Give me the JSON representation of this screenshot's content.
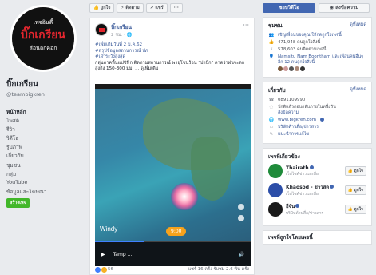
{
  "page": {
    "avatar_top": "เพจอินดี้",
    "avatar_mid": "บิ๊กเกรียน",
    "avatar_bot": "ส่อนถกคอก",
    "name": "บิ๊กเกรียน",
    "handle": "@teambigkren",
    "create_label": "สร้างเพจ"
  },
  "nav": [
    "หน้าหลัก",
    "โพสต์",
    "รีวิว",
    "วิดีโอ",
    "รูปภาพ",
    "เกี่ยวกับ",
    "ชุมชน",
    "กลุ่ม",
    "YouTube",
    "ข้อมูลและโฆษณา"
  ],
  "topbar": {
    "like": "ถูกใจ",
    "follow": "ติดตาม",
    "share": "แชร์",
    "more": "···"
  },
  "post": {
    "author": "บิ๊กเกรียน",
    "time": "2 ชม. · 🌐",
    "more": "···",
    "line1": "#เพิ่มเติมวันที่ 2 ม.ค.62",
    "line2": "#สรุปข้อมูลสถานการณ์ ปภ",
    "line3": "#เฝ้าระวังสูงสุด",
    "line4": "กลุ่มภาคพื้นแปซิฟิก ติดตามสถานการณ์ พายุโซนร้อน \"ปาบึก\" คาดว่าฝนจะตกสูงถึง 150-300 มม. ... ดูเพิ่มเติม",
    "windy": "Windy",
    "time_pill": "9:00",
    "video_label": "Tamp ...",
    "reaction_count": "56",
    "foot_right": "แชร์ 16 ครั้ง  รับชม 2.6 พัน ครั้ง",
    "progress": 0.32
  },
  "right": {
    "liked_label": "ชอบวิดีโอ",
    "message_label": "ส่งข้อความ",
    "community": {
      "title": "ชุมชน",
      "see_all": "ดูทั้งหมด",
      "rows": [
        "เชิญเพื่อนของคุณ ให้กดถูกใจเพจนี้",
        "471,948 คนถูกใจสิ่งนี้",
        "578,603 คนติดตามเพจนี้",
        "Namsitu Nam Boontham และเพื่อนคนอื่นๆ อีก 12 คนถูกใจสิ่งนี้"
      ]
    },
    "about": {
      "title": "เกี่ยวกับ",
      "see_all": "ดูทั้งหมด",
      "phone": "0891109990",
      "reply": "ปกติแล้วตอบกลับภายในหนึ่งวัน",
      "send_msg": "ส่งข้อความ",
      "website": "www.bigkren.com",
      "category": "บริษัทด้านสื่อ/ข่าวสาร",
      "suggest": "แนะนำการแก้ไข"
    },
    "related": {
      "title": "เพจที่เกี่ยวข้อง",
      "items": [
        {
          "name": "Thairath",
          "sub": "เว็บไซต์ข่าวและสื่อ",
          "like": "ถูกใจ",
          "color": "#1f8b3a"
        },
        {
          "name": "Khaosod - ข่าวสด",
          "sub": "เว็บไซต์ข่าวและสื่อ",
          "like": "ถูกใจ",
          "color": "#2c4ea8"
        },
        {
          "name": "อีจัน",
          "sub": "บริษัทด้านสื่อ/ข่าวสาร",
          "like": "ถูกใจ",
          "color": "#1a1a1a"
        }
      ]
    },
    "bottom_title": "เพจที่ถูกใจโดยเพจนี้"
  },
  "colors": {
    "fb_blue": "#4267b2",
    "link": "#385898",
    "green": "#42b72a"
  }
}
